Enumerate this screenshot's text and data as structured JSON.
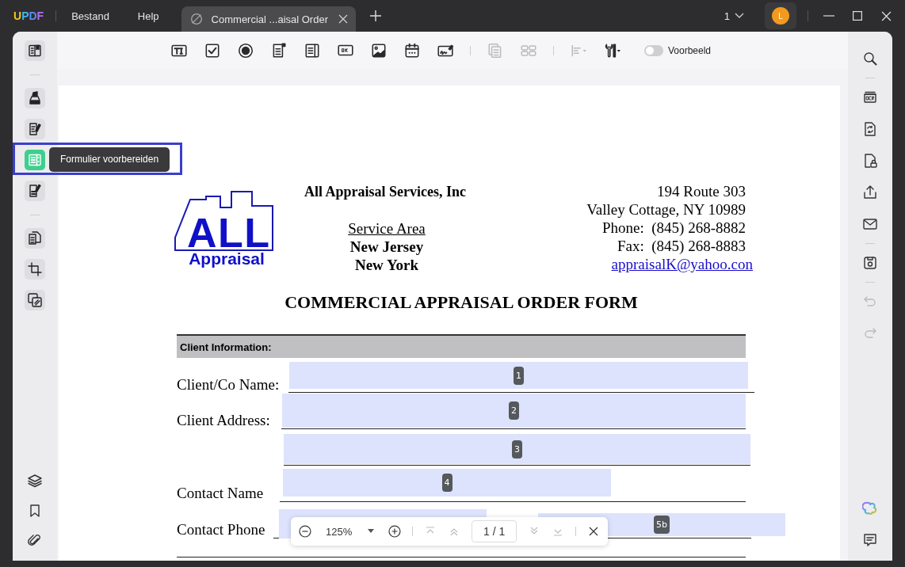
{
  "app": {
    "logo": [
      "U",
      "P",
      "D",
      "F"
    ],
    "menus": [
      "Bestand",
      "Help"
    ]
  },
  "tabs": [
    {
      "label": "Commercial ...aisal Order",
      "selected": true
    }
  ],
  "title_bar": {
    "page_number": "1",
    "avatar": "L"
  },
  "toolbar": {
    "tools": [
      {
        "kind": "text-field",
        "disabled": false
      },
      {
        "kind": "checkbox",
        "disabled": false
      },
      {
        "kind": "radio",
        "disabled": false
      },
      {
        "kind": "combo-box",
        "disabled": false
      },
      {
        "kind": "list-box",
        "disabled": false
      },
      {
        "kind": "ok-button",
        "disabled": false
      },
      {
        "kind": "image",
        "disabled": false
      },
      {
        "kind": "date",
        "disabled": false
      },
      {
        "kind": "signature",
        "disabled": false
      },
      {
        "kind": "sep"
      },
      {
        "kind": "duplicate",
        "disabled": true
      },
      {
        "kind": "grid",
        "disabled": true
      },
      {
        "kind": "sep"
      },
      {
        "kind": "align",
        "disabled": true
      },
      {
        "kind": "tools",
        "disabled": false
      }
    ],
    "preview": {
      "label": "Voorbeeld",
      "on": false
    }
  },
  "left_rail": {
    "items": [
      {
        "kind": "reader",
        "selected": false
      },
      {
        "kind": "sep"
      },
      {
        "kind": "highlight",
        "selected": false
      },
      {
        "kind": "edit",
        "selected": false
      },
      {
        "kind": "form",
        "selected": true
      },
      {
        "kind": "sign",
        "selected": false
      },
      {
        "kind": "sep"
      },
      {
        "kind": "pages",
        "selected": false
      },
      {
        "kind": "crop",
        "selected": false
      },
      {
        "kind": "overlay",
        "selected": false
      }
    ],
    "bottom": [
      {
        "kind": "layers"
      },
      {
        "kind": "bookmark"
      },
      {
        "kind": "attachment"
      }
    ],
    "tooltip": "Formulier voorbereiden"
  },
  "right_rail": {
    "items": [
      {
        "kind": "search",
        "disabled": false
      },
      {
        "kind": "sep"
      },
      {
        "kind": "ocr",
        "disabled": false
      },
      {
        "kind": "convert",
        "disabled": false
      },
      {
        "kind": "protect",
        "disabled": false
      },
      {
        "kind": "share",
        "disabled": false
      },
      {
        "kind": "mail",
        "disabled": false
      },
      {
        "kind": "sep"
      },
      {
        "kind": "save",
        "disabled": false
      },
      {
        "kind": "sep"
      },
      {
        "kind": "undo",
        "disabled": true
      },
      {
        "kind": "redo",
        "disabled": true
      }
    ],
    "bottom": [
      {
        "kind": "ai"
      },
      {
        "kind": "comment"
      }
    ]
  },
  "document": {
    "logo": {
      "big": "ALL",
      "small": "Appraisal"
    },
    "company": "All Appraisal Services, Inc",
    "service_area_heading": "Service Area",
    "service_areas": [
      "New Jersey",
      "New York"
    ],
    "address_lines": [
      "194 Route 303",
      "Valley Cottage, NY 10989",
      "Phone:  (845) 268-8882",
      "Fax:  (845) 268-8883"
    ],
    "email": "appraisalK@yahoo.con",
    "form_title": "COMMERCIAL APPRAISAL ORDER FORM",
    "section": "Client Information:",
    "rows": [
      {
        "label": "Client/Co Name:",
        "fields": [
          {
            "kind": "text-field",
            "number": "1"
          }
        ]
      },
      {
        "label": "Client Address:",
        "fields": [
          {
            "kind": "text-field",
            "number": "2"
          }
        ]
      },
      {
        "fields": [
          {
            "kind": "text-field",
            "number": "3"
          }
        ]
      },
      {
        "label": "Contact Name",
        "fields": [
          {
            "kind": "text-field",
            "number": "4"
          }
        ]
      },
      {
        "label": "Contact Phone",
        "fields": [
          {
            "kind": "text-field"
          },
          {
            "kind": "text-field",
            "number": "5b"
          }
        ]
      }
    ]
  },
  "zoom_bar": {
    "zoom": "125%",
    "page": "1 / 1"
  }
}
